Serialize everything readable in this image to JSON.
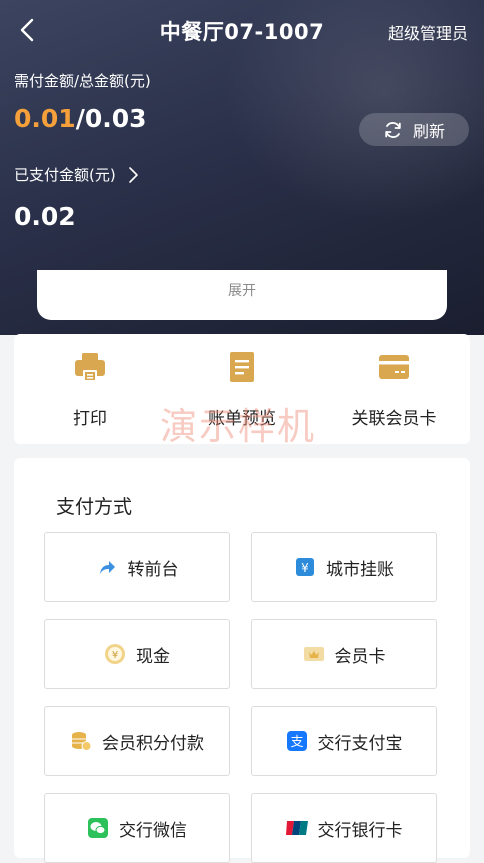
{
  "header": {
    "title": "中餐厅07-1007",
    "role": "超级管理员"
  },
  "summary": {
    "due_label": "需付金额/总金额(元)",
    "due_amount": "0.01",
    "separator": "/",
    "total_amount": "0.03",
    "refresh_label": "刷新",
    "paid_label": "已支付金额(元)",
    "paid_amount": "0.02",
    "expand_label": "展开"
  },
  "actions": [
    {
      "label": "打印",
      "icon": "printer-icon"
    },
    {
      "label": "账单预览",
      "icon": "bill-icon"
    },
    {
      "label": "关联会员卡",
      "icon": "member-card-icon"
    }
  ],
  "watermark": "演示样机",
  "payment": {
    "title": "支付方式",
    "methods": [
      {
        "label": "转前台",
        "icon": "forward-arrow-icon"
      },
      {
        "label": "城市挂账",
        "icon": "city-account-icon"
      },
      {
        "label": "现金",
        "icon": "cash-coin-icon"
      },
      {
        "label": "会员卡",
        "icon": "vip-card-icon"
      },
      {
        "label": "会员积分付款",
        "icon": "points-coins-icon"
      },
      {
        "label": "交行支付宝",
        "icon": "alipay-icon"
      },
      {
        "label": "交行微信",
        "icon": "wechat-icon"
      },
      {
        "label": "交行银行卡",
        "icon": "unionpay-icon"
      }
    ]
  },
  "colors": {
    "accent_orange": "#f5a03a",
    "gold_icon": "#d8a74f",
    "header_dark": "#2a3049"
  }
}
